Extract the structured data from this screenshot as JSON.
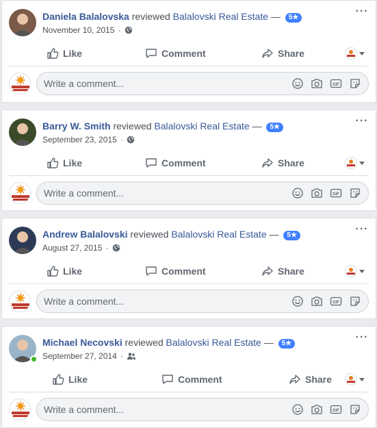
{
  "posts": [
    {
      "author": "Daniela Balalovska",
      "verb": "reviewed",
      "page": "Balalovski Real Estate",
      "dash": "—",
      "rating": "5★",
      "date": "November 10, 2015",
      "sep": "·",
      "audience_icon": "globe-icon",
      "avatar_color": "#7a5a48",
      "online": false,
      "actions": {
        "like": "Like",
        "comment": "Comment",
        "share": "Share"
      },
      "comment_placeholder": "Write a comment..."
    },
    {
      "author": "Barry W. Smith",
      "verb": "reviewed",
      "page": "Balalovski Real Estate",
      "dash": "—",
      "rating": "5★",
      "date": "September 23, 2015",
      "sep": "·",
      "audience_icon": "globe-icon",
      "avatar_color": "#3b4b2a",
      "online": false,
      "actions": {
        "like": "Like",
        "comment": "Comment",
        "share": "Share"
      },
      "comment_placeholder": "Write a comment..."
    },
    {
      "author": "Andrew Balalovski",
      "verb": "reviewed",
      "page": "Balalovski Real Estate",
      "dash": "—",
      "rating": "5★",
      "date": "August 27, 2015",
      "sep": "·",
      "audience_icon": "globe-icon",
      "avatar_color": "#2d3a55",
      "online": false,
      "actions": {
        "like": "Like",
        "comment": "Comment",
        "share": "Share"
      },
      "comment_placeholder": "Write a comment..."
    },
    {
      "author": "Michael Necovski",
      "verb": "reviewed",
      "page": "Balalovski Real Estate",
      "dash": "—",
      "rating": "5★",
      "date": "September 27, 2014",
      "sep": "·",
      "audience_icon": "friends-icon",
      "avatar_color": "#9ab4c8",
      "online": true,
      "actions": {
        "like": "Like",
        "comment": "Comment",
        "share": "Share"
      },
      "comment_placeholder": "Write a comment..."
    }
  ],
  "commenter_logo_text": "BALALOVSKI REAL ESTATE",
  "commenter_logo_color": "#c0392b",
  "accent": "#385898",
  "badge_color": "#4080ff"
}
